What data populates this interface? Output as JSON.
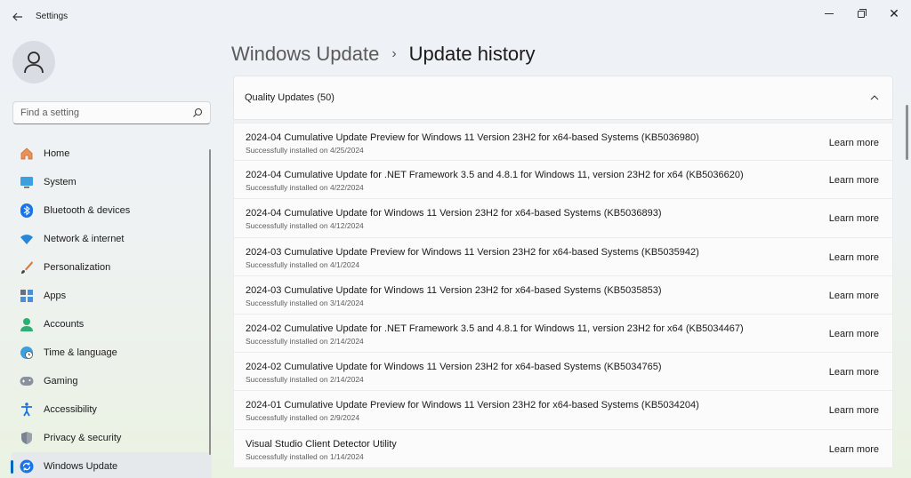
{
  "app": {
    "title": "Settings",
    "back_icon": "back-arrow-icon"
  },
  "window_controls": [
    "minimize-icon",
    "restore-icon",
    "close-icon"
  ],
  "search": {
    "placeholder": "Find a setting"
  },
  "sidebar": {
    "items": [
      {
        "label": "Home",
        "icon": "home-icon"
      },
      {
        "label": "System",
        "icon": "system-icon"
      },
      {
        "label": "Bluetooth & devices",
        "icon": "bluetooth-icon"
      },
      {
        "label": "Network & internet",
        "icon": "wifi-icon"
      },
      {
        "label": "Personalization",
        "icon": "brush-icon"
      },
      {
        "label": "Apps",
        "icon": "apps-icon"
      },
      {
        "label": "Accounts",
        "icon": "accounts-icon"
      },
      {
        "label": "Time & language",
        "icon": "globe-clock-icon"
      },
      {
        "label": "Gaming",
        "icon": "gamepad-icon"
      },
      {
        "label": "Accessibility",
        "icon": "accessibility-icon"
      },
      {
        "label": "Privacy & security",
        "icon": "shield-icon"
      },
      {
        "label": "Windows Update",
        "icon": "windows-update-icon",
        "active": true
      }
    ]
  },
  "breadcrumb": {
    "parent": "Windows Update",
    "current": "Update history"
  },
  "section": {
    "label": "Quality Updates (50)",
    "expanded": true
  },
  "updates": [
    {
      "title": "2024-04 Cumulative Update Preview for Windows 11 Version 23H2 for x64-based Systems (KB5036980)",
      "status": "Successfully installed on 4/25/2024",
      "link": "Learn more"
    },
    {
      "title": "2024-04 Cumulative Update for .NET Framework 3.5 and 4.8.1 for Windows 11, version 23H2 for x64 (KB5036620)",
      "status": "Successfully installed on 4/22/2024",
      "link": "Learn more"
    },
    {
      "title": "2024-04 Cumulative Update for Windows 11 Version 23H2 for x64-based Systems (KB5036893)",
      "status": "Successfully installed on 4/12/2024",
      "link": "Learn more"
    },
    {
      "title": "2024-03 Cumulative Update Preview for Windows 11 Version 23H2 for x64-based Systems (KB5035942)",
      "status": "Successfully installed on 4/1/2024",
      "link": "Learn more"
    },
    {
      "title": "2024-03 Cumulative Update for Windows 11 Version 23H2 for x64-based Systems (KB5035853)",
      "status": "Successfully installed on 3/14/2024",
      "link": "Learn more"
    },
    {
      "title": "2024-02 Cumulative Update for .NET Framework 3.5 and 4.8.1 for Windows 11, version 23H2 for x64 (KB5034467)",
      "status": "Successfully installed on 2/14/2024",
      "link": "Learn more"
    },
    {
      "title": "2024-02 Cumulative Update for Windows 11 Version 23H2 for x64-based Systems (KB5034765)",
      "status": "Successfully installed on 2/14/2024",
      "link": "Learn more"
    },
    {
      "title": "2024-01 Cumulative Update Preview for Windows 11 Version 23H2 for x64-based Systems (KB5034204)",
      "status": "Successfully installed on 2/9/2024",
      "link": "Learn more"
    },
    {
      "title": "Visual Studio Client Detector Utility",
      "status": "Successfully installed on 1/14/2024",
      "link": "Learn more"
    }
  ],
  "colors": {
    "accent": "#0067c0",
    "bluetooth": "#1a73e8",
    "home": "#e07a3a"
  }
}
